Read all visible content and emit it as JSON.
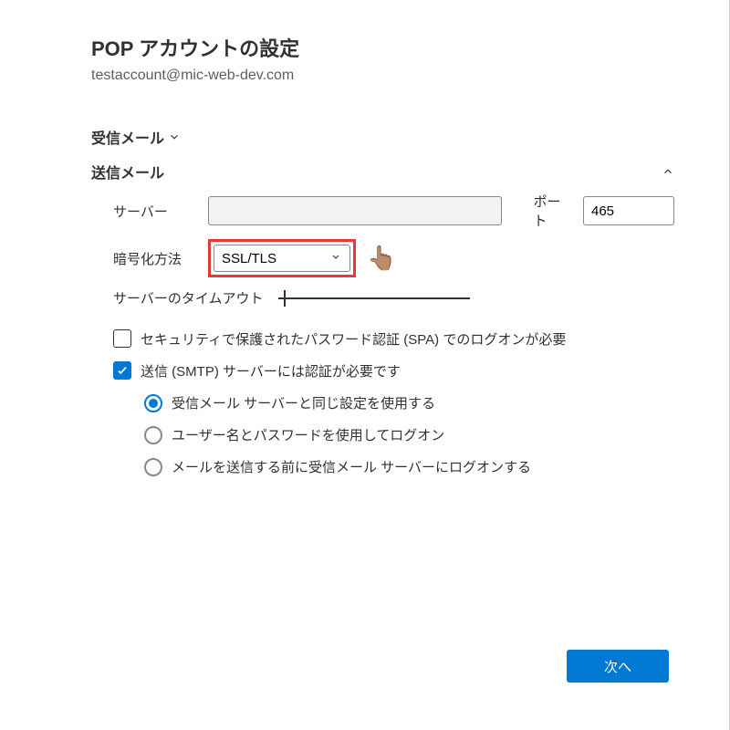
{
  "title": "POP アカウントの設定",
  "email": "testaccount@mic-web-dev.com",
  "sections": {
    "incoming": {
      "label": "受信メール",
      "expanded": false
    },
    "outgoing": {
      "label": "送信メール",
      "expanded": true
    }
  },
  "outgoing": {
    "server_label": "サーバー",
    "server_value": "",
    "port_label": "ポート",
    "port_value": "465",
    "encryption_label": "暗号化方法",
    "encryption_value": "SSL/TLS",
    "timeout_label": "サーバーのタイムアウト",
    "checkbox_spa": {
      "label": "セキュリティで保護されたパスワード認証 (SPA) でのログオンが必要",
      "checked": false
    },
    "checkbox_smtp_auth": {
      "label": "送信 (SMTP) サーバーには認証が必要です",
      "checked": true
    },
    "radio_options": [
      {
        "label": "受信メール サーバーと同じ設定を使用する",
        "selected": true
      },
      {
        "label": "ユーザー名とパスワードを使用してログオン",
        "selected": false
      },
      {
        "label": "メールを送信する前に受信メール サーバーにログオンする",
        "selected": false
      }
    ]
  },
  "buttons": {
    "next": "次へ"
  },
  "colors": {
    "accent": "#0078d4",
    "highlight_border": "#e53935"
  }
}
